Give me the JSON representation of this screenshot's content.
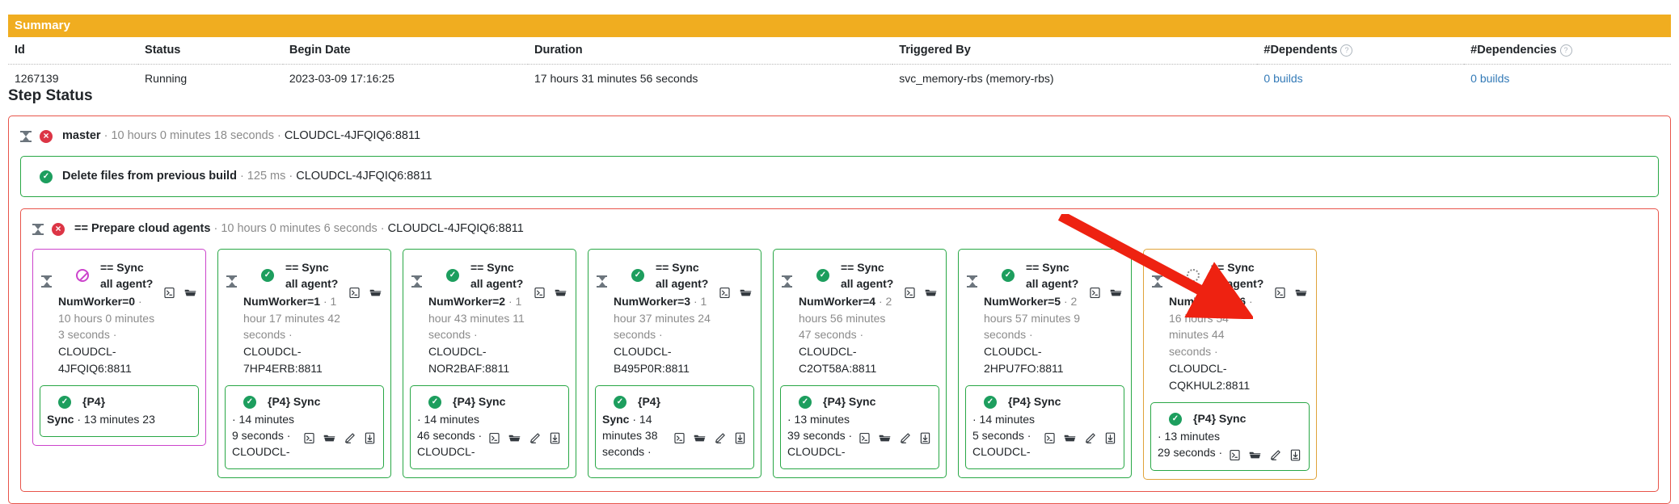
{
  "summary": {
    "panel_title": "Summary",
    "columns": [
      "Id",
      "Status",
      "Begin Date",
      "Duration",
      "Triggered By",
      "#Dependents",
      "#Dependencies"
    ],
    "help_glyph": "?",
    "row": {
      "id": "1267139",
      "status": "Running",
      "begin_date": "2023-03-09 17:16:25",
      "duration": "17 hours 31 minutes 56 seconds",
      "triggered_by": "svc_memory-rbs (memory-rbs)",
      "dependents": "0 builds",
      "dependencies": "0 builds"
    }
  },
  "step_status": {
    "heading": "Step Status",
    "master": {
      "title": "master",
      "meta": " · 10 hours 0 minutes 18 seconds · ",
      "host": "CLOUDCL-4JFQIQ6:8811",
      "state": "fail"
    },
    "delete_step": {
      "title": "Delete files from previous build",
      "meta": " · 125 ms · ",
      "host": "CLOUDCL-4JFQIQ6:8811",
      "state": "ok"
    },
    "prepare_step": {
      "title": "== Prepare cloud agents",
      "meta": " · 10 hours 0 minutes 6 seconds · ",
      "host": "CLOUDCL-4JFQIQ6:8811",
      "state": "fail"
    },
    "cards": [
      {
        "state": "skip",
        "border": "purple",
        "title": "== Sync all agent?",
        "worker_label": "NumWorker=0",
        "duration": " · 10 hours 0 minutes 3 seconds · ",
        "host": "CLOUDCL-4JFQIQ6:8811",
        "icons": [
          "console-icon",
          "folder-icon"
        ],
        "sub": {
          "state": "ok",
          "title": "{P4}",
          "bold_word": "Sync",
          "duration": " · 13 minutes 23",
          "tail": "",
          "icons": []
        }
      },
      {
        "state": "ok",
        "border": "green",
        "title": "== Sync all agent?",
        "worker_label": "NumWorker=1",
        "duration": " · 1 hour 17 minutes 42 seconds · ",
        "host": "CLOUDCL-7HP4ERB:8811",
        "icons": [
          "console-icon",
          "folder-icon"
        ],
        "sub": {
          "state": "ok",
          "title": "{P4} Sync",
          "bold_word": "",
          "duration": " · 14 minutes 9 seconds · ",
          "tail": "CLOUDCL-",
          "icons": [
            "console-icon",
            "folder-icon",
            "edit-icon",
            "download-icon"
          ]
        }
      },
      {
        "state": "ok",
        "border": "green",
        "title": "== Sync all agent?",
        "worker_label": "NumWorker=2",
        "duration": " · 1 hour 43 minutes 11 seconds · ",
        "host": "CLOUDCL-NOR2BAF:8811",
        "icons": [
          "console-icon",
          "folder-icon"
        ],
        "sub": {
          "state": "ok",
          "title": "{P4} Sync",
          "bold_word": "",
          "duration": " · 14 minutes 46 seconds · ",
          "tail": "CLOUDCL-",
          "icons": [
            "console-icon",
            "folder-icon",
            "edit-icon",
            "download-icon"
          ]
        }
      },
      {
        "state": "ok",
        "border": "green",
        "title": "== Sync all agent?",
        "worker_label": "NumWorker=3",
        "duration": " · 1 hour 37 minutes 24 seconds · ",
        "host": "CLOUDCL-B495P0R:8811",
        "icons": [
          "console-icon",
          "folder-icon"
        ],
        "sub": {
          "state": "ok",
          "title": "{P4}",
          "bold_word": "Sync",
          "duration": " · 14 minutes 38 seconds ·",
          "tail": "",
          "icons": [
            "console-icon",
            "folder-icon",
            "edit-icon",
            "download-icon"
          ]
        }
      },
      {
        "state": "ok",
        "border": "green",
        "title": "== Sync all agent?",
        "worker_label": "NumWorker=4",
        "duration": " · 2 hours 56 minutes 47 seconds · ",
        "host": "CLOUDCL-C2OT58A:8811",
        "icons": [
          "console-icon",
          "folder-icon"
        ],
        "sub": {
          "state": "ok",
          "title": "{P4} Sync",
          "bold_word": "",
          "duration": " · 13 minutes 39 seconds · ",
          "tail": "CLOUDCL-",
          "icons": [
            "console-icon",
            "folder-icon",
            "edit-icon",
            "download-icon"
          ]
        }
      },
      {
        "state": "ok",
        "border": "green",
        "title": "== Sync all agent?",
        "worker_label": "NumWorker=5",
        "duration": " · 2 hours 57 minutes 9 seconds · ",
        "host": "CLOUDCL-2HPU7FO:8811",
        "icons": [
          "console-icon",
          "folder-icon"
        ],
        "sub": {
          "state": "ok",
          "title": "{P4} Sync",
          "bold_word": "",
          "duration": " · 14 minutes 5 seconds · ",
          "tail": "CLOUDCL-",
          "icons": [
            "console-icon",
            "folder-icon",
            "edit-icon",
            "download-icon"
          ]
        }
      },
      {
        "state": "running",
        "border": "amber",
        "title": "== Sync all agent?",
        "worker_label": "NumWorker=6",
        "duration": " · 16 hours 54 minutes 44 seconds · ",
        "host": "CQKHUL2:8811",
        "host_prefix": "CLOUDCL-",
        "icons": [
          "console-icon",
          "folder-icon"
        ],
        "sub": {
          "state": "ok",
          "title": "{P4} Sync",
          "bold_word": "",
          "duration": " · 13 minutes 29 seconds ·",
          "tail": "",
          "icons": [
            "console-icon",
            "folder-icon",
            "edit-icon",
            "download-icon"
          ]
        }
      }
    ]
  },
  "annotation": {
    "arrow_color": "#ee2211",
    "points_to": "NumWorker=6 card"
  },
  "colors": {
    "summary_header": "#f0ad20",
    "link": "#337ab7",
    "fail": "#dc3545",
    "ok": "#1d9e5e",
    "skip": "#cc44cc",
    "amber": "#e0a33a"
  }
}
